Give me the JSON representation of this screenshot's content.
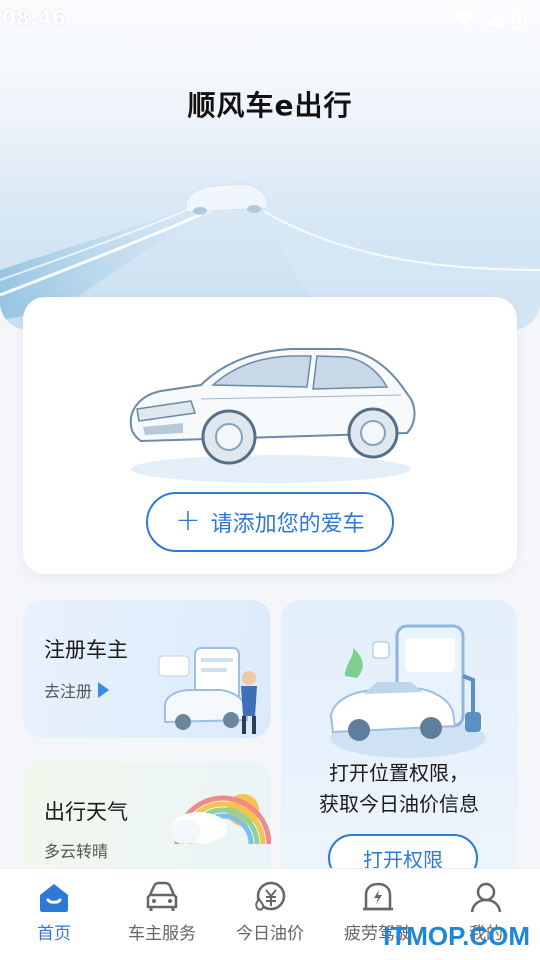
{
  "status_bar": {
    "time": "08:46",
    "icons": [
      "wifi-icon",
      "signal-icon",
      "battery-icon"
    ]
  },
  "app": {
    "title": "顺风车e出行"
  },
  "add_car": {
    "button_label": "请添加您的爱车",
    "plus": "+"
  },
  "tiles": {
    "register": {
      "title": "注册车主",
      "link": "去注册"
    },
    "weather": {
      "title": "出行天气",
      "sub": "多云转晴"
    },
    "location": {
      "line1": "打开位置权限，",
      "line2": "获取今日油价信息",
      "button_label": "打开权限"
    }
  },
  "tabs": [
    {
      "label": "首页",
      "icon": "home-icon",
      "active": true
    },
    {
      "label": "车主服务",
      "icon": "car-icon",
      "active": false
    },
    {
      "label": "今日油价",
      "icon": "fuel-price-icon",
      "active": false
    },
    {
      "label": "疲劳驾驶",
      "icon": "fatigue-icon",
      "active": false
    },
    {
      "label": "我的",
      "icon": "profile-icon",
      "active": false
    }
  ],
  "watermark": "ITMOP.COM",
  "colors": {
    "accent": "#2f79d6",
    "tab_active": "#2f79d6",
    "watermark": "#1f86d8"
  }
}
